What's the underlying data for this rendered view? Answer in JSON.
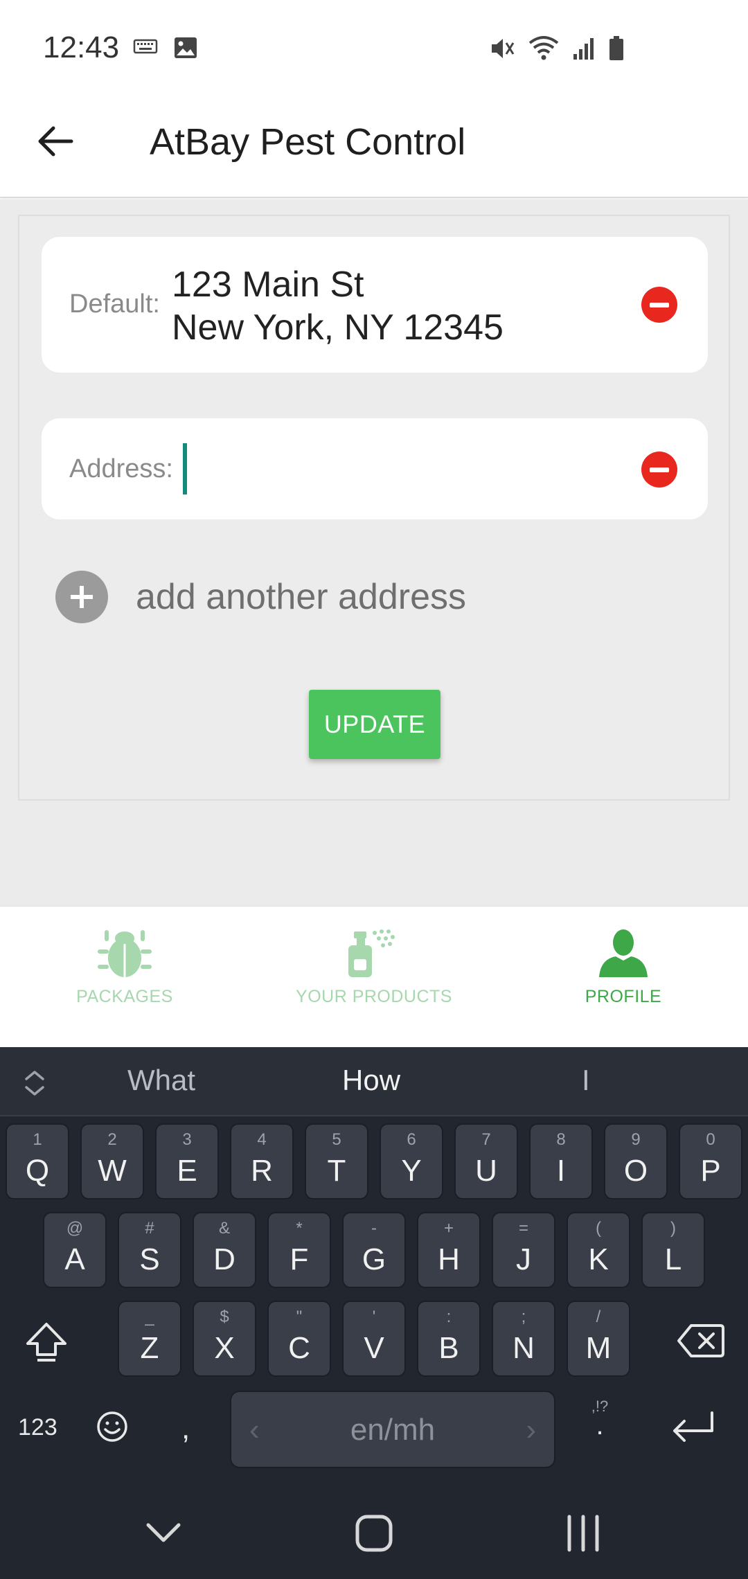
{
  "status_bar": {
    "time": "12:43",
    "left_icons": [
      "keyboard-icon",
      "image-icon"
    ],
    "right_icons": [
      "mute-icon",
      "wifi-icon",
      "signal-icon",
      "battery-icon"
    ]
  },
  "app_bar": {
    "title": "AtBay Pest Control",
    "back_icon": "arrow-left-icon"
  },
  "addresses": {
    "default_label": "Default:",
    "default_line1": "123 Main St",
    "default_line2": "New York, NY 12345",
    "address_label": "Address:",
    "address_value": "",
    "remove_icon": "minus-circle-icon"
  },
  "add_address": {
    "label": "add another address",
    "icon": "plus-circle-icon"
  },
  "update_button": {
    "label": "UPDATE"
  },
  "bottom_nav": {
    "items": [
      {
        "label": "PACKAGES",
        "icon": "bug-icon",
        "active": false
      },
      {
        "label": "YOUR PRODUCTS",
        "icon": "spray-bottle-icon",
        "active": false
      },
      {
        "label": "PROFILE",
        "icon": "person-icon",
        "active": true
      }
    ]
  },
  "keyboard": {
    "suggestions": [
      "What",
      "How",
      "I"
    ],
    "row1": [
      {
        "hint": "1",
        "key": "Q"
      },
      {
        "hint": "2",
        "key": "W"
      },
      {
        "hint": "3",
        "key": "E"
      },
      {
        "hint": "4",
        "key": "R"
      },
      {
        "hint": "5",
        "key": "T"
      },
      {
        "hint": "6",
        "key": "Y"
      },
      {
        "hint": "7",
        "key": "U"
      },
      {
        "hint": "8",
        "key": "I"
      },
      {
        "hint": "9",
        "key": "O"
      },
      {
        "hint": "0",
        "key": "P"
      }
    ],
    "row2": [
      {
        "hint": "@",
        "key": "A"
      },
      {
        "hint": "#",
        "key": "S"
      },
      {
        "hint": "&",
        "key": "D"
      },
      {
        "hint": "*",
        "key": "F"
      },
      {
        "hint": "-",
        "key": "G"
      },
      {
        "hint": "+",
        "key": "H"
      },
      {
        "hint": "=",
        "key": "J"
      },
      {
        "hint": "(",
        "key": "K"
      },
      {
        "hint": ")",
        "key": "L"
      }
    ],
    "row3": [
      {
        "hint": "_",
        "key": "Z"
      },
      {
        "hint": "$",
        "key": "X"
      },
      {
        "hint": "\"",
        "key": "C"
      },
      {
        "hint": "'",
        "key": "V"
      },
      {
        "hint": ":",
        "key": "B"
      },
      {
        "hint": ";",
        "key": "N"
      },
      {
        "hint": "/",
        "key": "M"
      }
    ],
    "symbols_label": "123",
    "comma": ",",
    "space_label": "en/mh",
    "punct_hint": ",!?",
    "period": "."
  },
  "colors": {
    "accent_green": "#4cc45d",
    "remove_red": "#e8281f",
    "caret_teal": "#138a7e",
    "nav_inactive": "#a6d7ad",
    "nav_active": "#3ea848",
    "keyboard_bg": "#22262f"
  }
}
